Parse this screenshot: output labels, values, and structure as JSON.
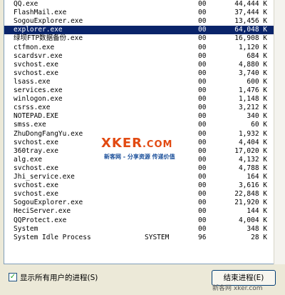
{
  "processes": [
    {
      "name": "QQ.exe",
      "user": "",
      "cpu": "00",
      "mem": "44,444 K",
      "selected": false
    },
    {
      "name": "FlashMail.exe",
      "user": "",
      "cpu": "00",
      "mem": "37,444 K",
      "selected": false
    },
    {
      "name": "SogouExplorer.exe",
      "user": "",
      "cpu": "00",
      "mem": "13,456 K",
      "selected": false
    },
    {
      "name": "explorer.exe",
      "user": "",
      "cpu": "00",
      "mem": "64,048 K",
      "selected": true
    },
    {
      "name": "绿坝FTP数据备份.exe",
      "user": "",
      "cpu": "00",
      "mem": "16,908 K",
      "selected": false
    },
    {
      "name": "ctfmon.exe",
      "user": "",
      "cpu": "00",
      "mem": "1,120 K",
      "selected": false
    },
    {
      "name": "scardsvr.exe",
      "user": "",
      "cpu": "00",
      "mem": "684 K",
      "selected": false
    },
    {
      "name": "svchost.exe",
      "user": "",
      "cpu": "00",
      "mem": "4,880 K",
      "selected": false
    },
    {
      "name": "svchost.exe",
      "user": "",
      "cpu": "00",
      "mem": "3,740 K",
      "selected": false
    },
    {
      "name": "lsass.exe",
      "user": "",
      "cpu": "00",
      "mem": "600 K",
      "selected": false
    },
    {
      "name": "services.exe",
      "user": "",
      "cpu": "00",
      "mem": "1,476 K",
      "selected": false
    },
    {
      "name": "winlogon.exe",
      "user": "",
      "cpu": "00",
      "mem": "1,148 K",
      "selected": false
    },
    {
      "name": "csrss.exe",
      "user": "",
      "cpu": "00",
      "mem": "3,212 K",
      "selected": false
    },
    {
      "name": "NOTEPAD.EXE",
      "user": "",
      "cpu": "00",
      "mem": "340 K",
      "selected": false
    },
    {
      "name": "smss.exe",
      "user": "",
      "cpu": "00",
      "mem": "60 K",
      "selected": false
    },
    {
      "name": "ZhuDongFangYu.exe",
      "user": "",
      "cpu": "00",
      "mem": "1,932 K",
      "selected": false
    },
    {
      "name": "svchost.exe",
      "user": "",
      "cpu": "00",
      "mem": "4,404 K",
      "selected": false
    },
    {
      "name": "360tray.exe",
      "user": "",
      "cpu": "00",
      "mem": "17,020 K",
      "selected": false
    },
    {
      "name": "alg.exe",
      "user": "",
      "cpu": "00",
      "mem": "4,132 K",
      "selected": false
    },
    {
      "name": "svchost.exe",
      "user": "",
      "cpu": "00",
      "mem": "4,788 K",
      "selected": false
    },
    {
      "name": "Jhi_service.exe",
      "user": "",
      "cpu": "00",
      "mem": "164 K",
      "selected": false
    },
    {
      "name": "svchost.exe",
      "user": "",
      "cpu": "00",
      "mem": "3,616 K",
      "selected": false
    },
    {
      "name": "svchost.exe",
      "user": "",
      "cpu": "00",
      "mem": "22,848 K",
      "selected": false
    },
    {
      "name": "SogouExplorer.exe",
      "user": "",
      "cpu": "00",
      "mem": "21,920 K",
      "selected": false
    },
    {
      "name": "HeciServer.exe",
      "user": "",
      "cpu": "00",
      "mem": "144 K",
      "selected": false
    },
    {
      "name": "QQProtect.exe",
      "user": "",
      "cpu": "00",
      "mem": "4,004 K",
      "selected": false
    },
    {
      "name": "System",
      "user": "",
      "cpu": "00",
      "mem": "348 K",
      "selected": false
    },
    {
      "name": "System Idle Process",
      "user": "SYSTEM",
      "cpu": "96",
      "mem": "28 K",
      "selected": false
    }
  ],
  "watermark": {
    "logo_a": "XKER",
    "logo_b": ".COM",
    "tagline": "新客网 - 分享资源 传递价值"
  },
  "footer": {
    "checkbox_mark": "✓",
    "show_all_users_label": "显示所有用户的进程(S)",
    "end_process_label": "结束进程(E)",
    "site_text": "新客网 xker.com"
  },
  "colors": {
    "selection": "#0a246a",
    "window_bg": "#ece9d8"
  }
}
